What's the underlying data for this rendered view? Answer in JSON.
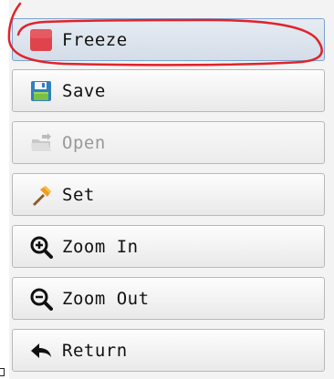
{
  "toolbar": {
    "buttons": [
      {
        "label": "Freeze",
        "icon": "stop-square-icon",
        "state": "active"
      },
      {
        "label": "Save",
        "icon": "floppy-disk-icon",
        "state": "enabled"
      },
      {
        "label": "Open",
        "icon": "folder-open-icon",
        "state": "disabled"
      },
      {
        "label": "Set",
        "icon": "hammer-icon",
        "state": "enabled"
      },
      {
        "label": "Zoom In",
        "icon": "zoom-in-icon",
        "state": "enabled"
      },
      {
        "label": "Zoom Out",
        "icon": "zoom-out-icon",
        "state": "enabled"
      },
      {
        "label": "Return",
        "icon": "return-arrow-icon",
        "state": "enabled"
      }
    ]
  },
  "colors": {
    "freeze_icon": "#e0434c",
    "annotation_stroke": "#e0232b",
    "active_border": "#7da2ce"
  }
}
